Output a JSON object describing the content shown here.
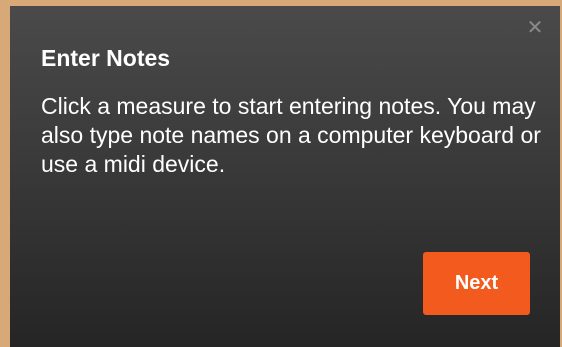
{
  "popover": {
    "title": "Enter Notes",
    "body": "Click a measure to start entering notes. You may also type note names on a computer keyboard or use a midi device.",
    "close_glyph": "✕",
    "next_label": "Next"
  },
  "colors": {
    "backdrop": "#d7a878",
    "popover_top": "#4a4a4a",
    "popover_bottom": "#252525",
    "accent": "#f25a1e",
    "close_icon": "#8a8a8a"
  },
  "icons": {
    "close": "close-icon"
  }
}
